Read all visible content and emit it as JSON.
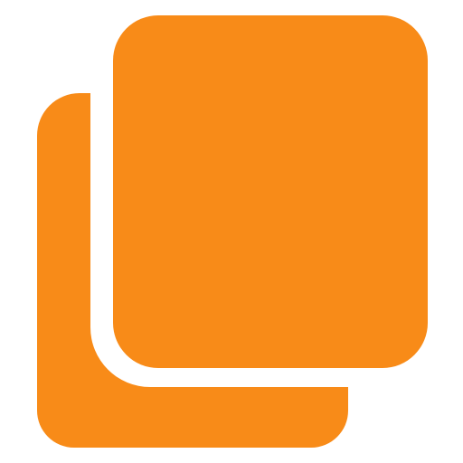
{
  "icon": {
    "name": "copy-icon",
    "color": "#F88B18",
    "background": "#FFFFFF"
  }
}
